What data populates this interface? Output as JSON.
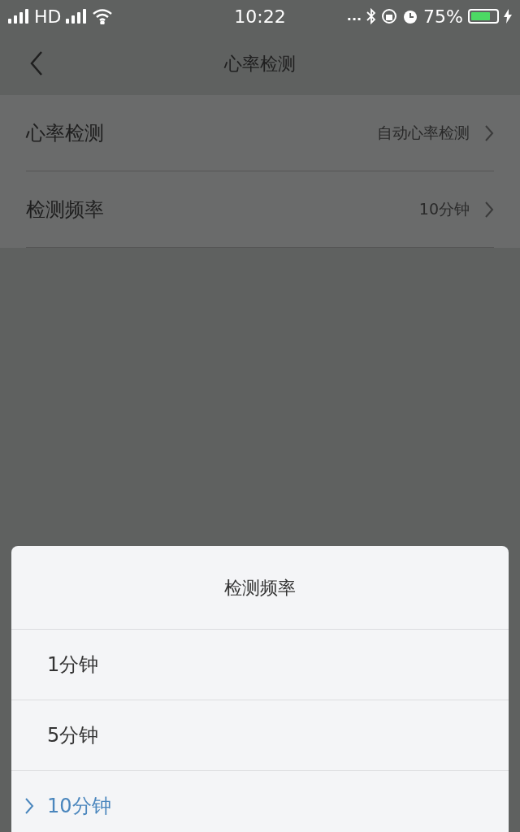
{
  "status_bar": {
    "network": "HD",
    "time": "10:22",
    "dots": "...",
    "battery": "75%"
  },
  "header": {
    "title": "心率检测"
  },
  "settings": [
    {
      "label": "心率检测",
      "value": "自动心率检测"
    },
    {
      "label": "检测频率",
      "value": "10分钟"
    }
  ],
  "sheet": {
    "title": "检测频率",
    "options": [
      {
        "label": "1分钟",
        "selected": false
      },
      {
        "label": "5分钟",
        "selected": false
      },
      {
        "label": "10分钟",
        "selected": true
      }
    ]
  }
}
